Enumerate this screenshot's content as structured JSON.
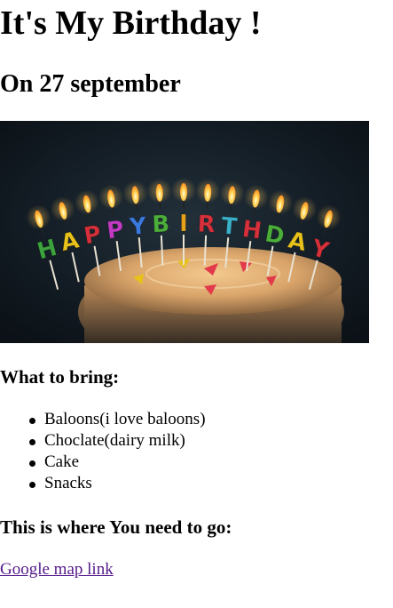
{
  "page": {
    "title": "It's My Birthday !",
    "date_heading": "On 27 september"
  },
  "image": {
    "subject": "birthday-cake-with-happy-birthday-candles",
    "candle_letters": [
      "H",
      "A",
      "P",
      "P",
      "Y",
      "B",
      "I",
      "R",
      "T",
      "H",
      "D",
      "A",
      "Y"
    ],
    "candle_colors": [
      "#3ca23c",
      "#e8c21a",
      "#d6303a",
      "#c23ac2",
      "#3a7ae0",
      "#4caf3a",
      "#e8a21a",
      "#d6303a",
      "#3ab0c8",
      "#d6303a",
      "#4caf3a",
      "#e8c21a",
      "#d6303a"
    ]
  },
  "bring": {
    "heading": "What to bring:",
    "items": [
      "Baloons(i love baloons)",
      "Choclate(dairy milk)",
      "Cake",
      "Snacks"
    ]
  },
  "location": {
    "heading": "This is where You need to go:",
    "link_text": "Google map link"
  },
  "colors": {
    "link_visited": "#551a8b"
  }
}
